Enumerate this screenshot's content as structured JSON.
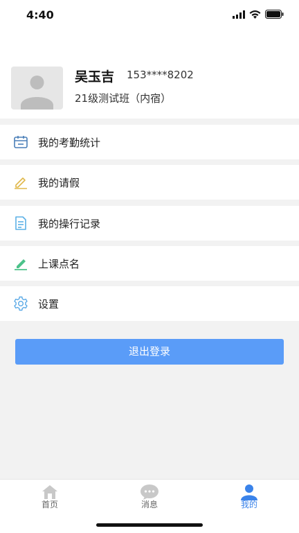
{
  "status_bar": {
    "time": "4:40"
  },
  "profile": {
    "name": "吴玉吉",
    "phone": "153****8202",
    "class_name": "21级测试班（内宿）"
  },
  "menu": {
    "items": [
      {
        "label": "我的考勤统计",
        "icon": "calendar-icon",
        "color": "#4a7fb8"
      },
      {
        "label": "我的请假",
        "icon": "pencil-icon",
        "color": "#e0b84a"
      },
      {
        "label": "我的操行记录",
        "icon": "document-icon",
        "color": "#5bb0e6"
      },
      {
        "label": "上课点名",
        "icon": "edit-icon",
        "color": "#4cc28a"
      },
      {
        "label": "设置",
        "icon": "gear-icon",
        "color": "#5aa9e6"
      }
    ]
  },
  "logout": {
    "label": "退出登录",
    "color": "#5a9cf8"
  },
  "tab_bar": {
    "tabs": [
      {
        "label": "首页",
        "icon": "home-icon",
        "active": false
      },
      {
        "label": "消息",
        "icon": "message-icon",
        "active": false
      },
      {
        "label": "我的",
        "icon": "person-icon",
        "active": true
      }
    ],
    "active_color": "#3a83ea"
  }
}
